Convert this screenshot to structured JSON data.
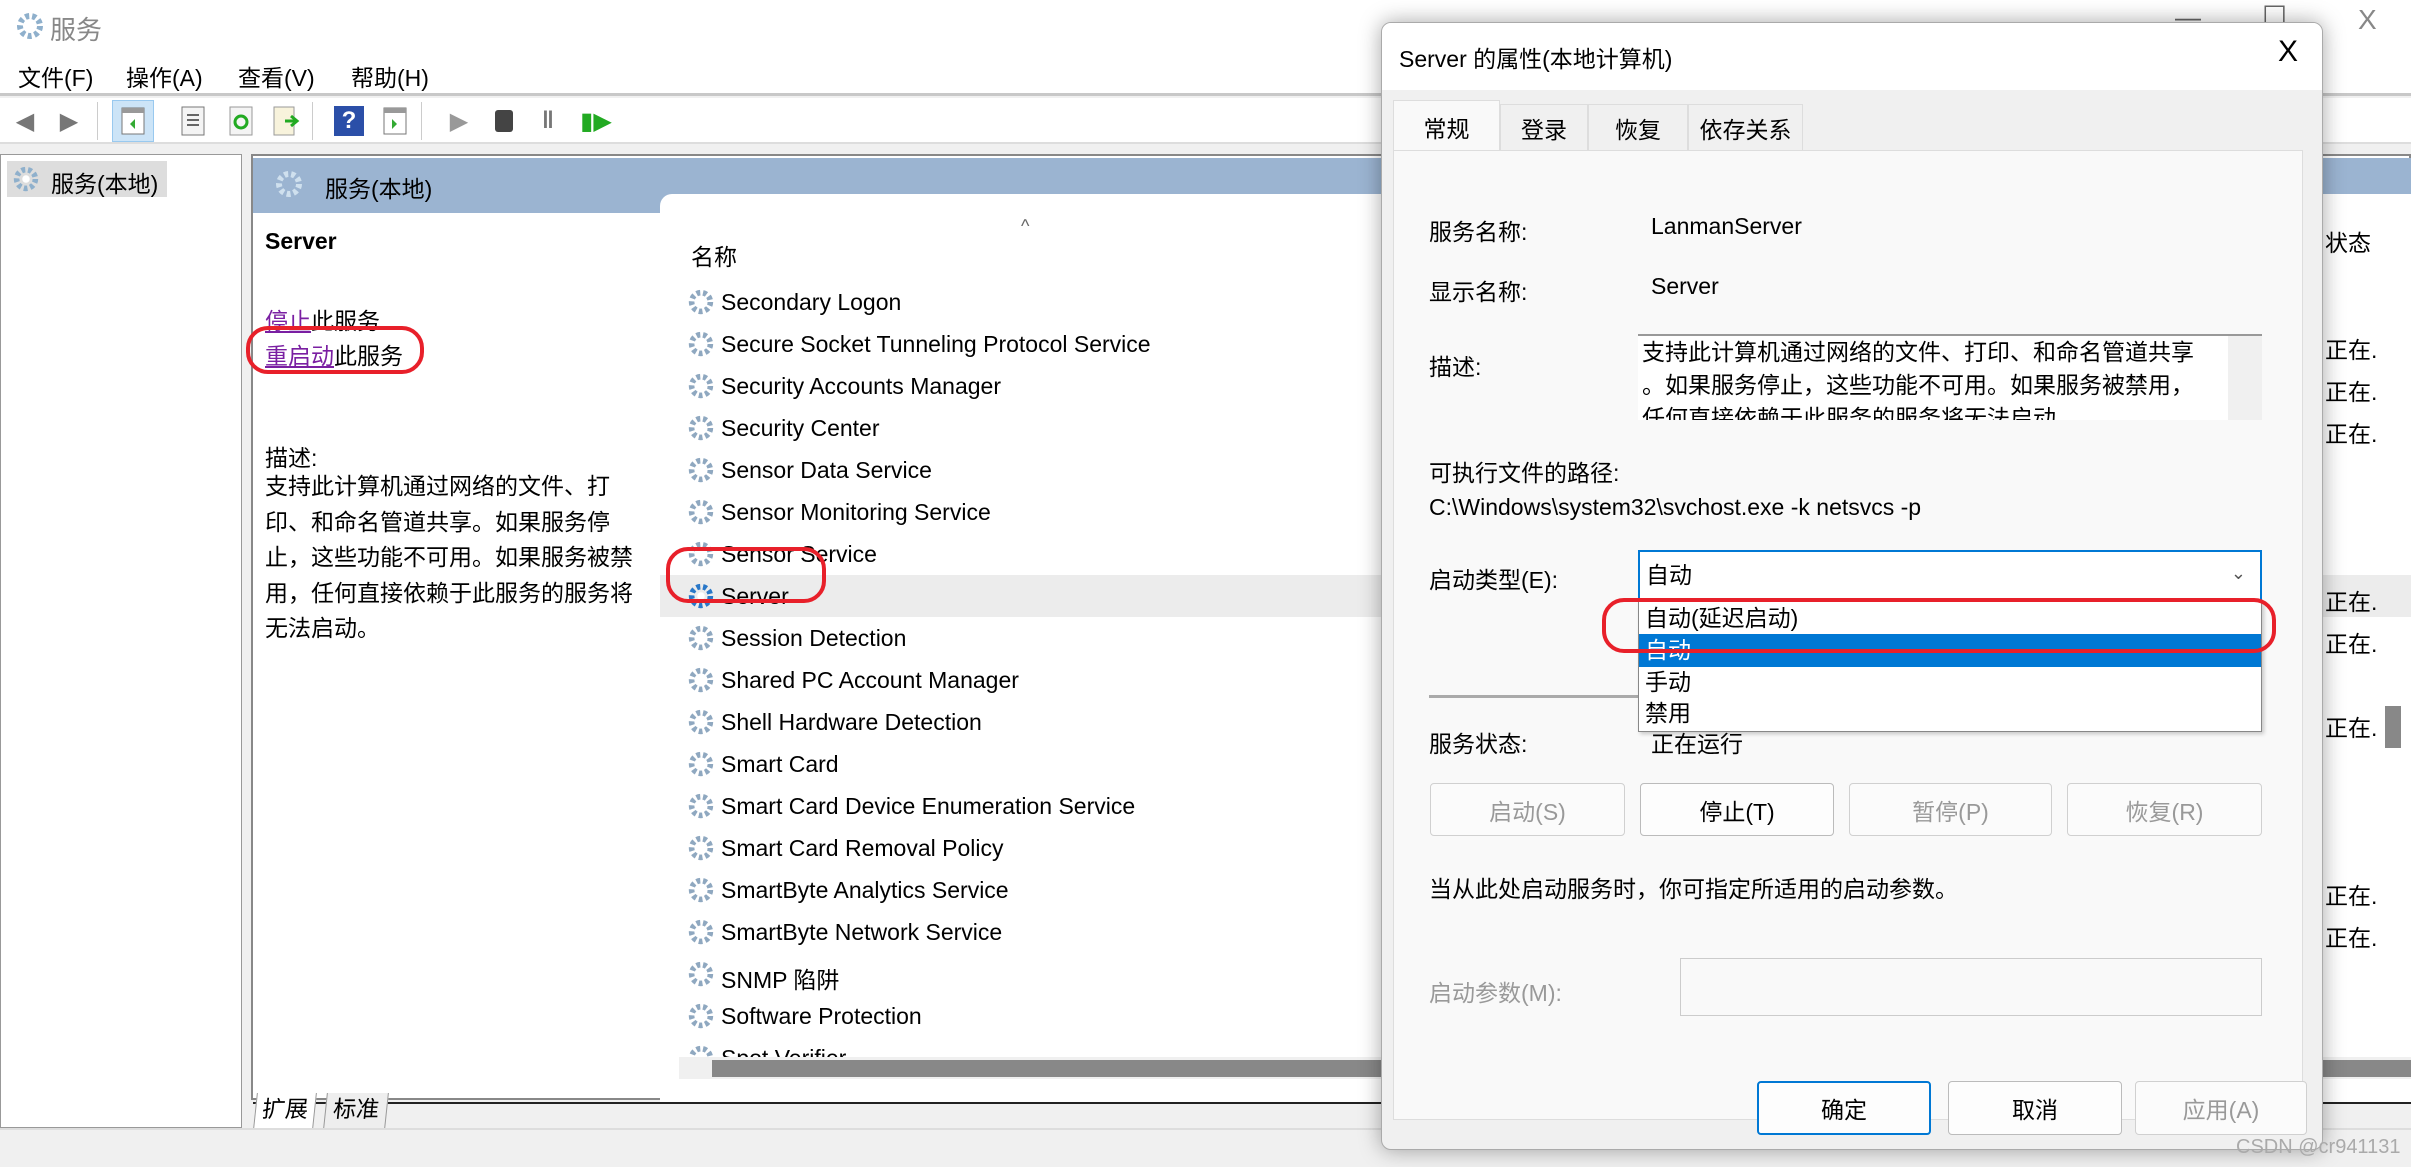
{
  "window": {
    "title": "服务",
    "controls": {
      "minimize": "—",
      "maximize": "☐",
      "close": "X"
    }
  },
  "menu": [
    "文件(F)",
    "操作(A)",
    "查看(V)",
    "帮助(H)"
  ],
  "toolbar": [
    "back-icon",
    "forward-icon",
    "show-hide-console-tree-icon",
    "properties-icon",
    "refresh-icon",
    "export-list-icon",
    "help-icon",
    "show-action-pane-icon",
    "start-service-icon",
    "stop-service-icon",
    "pause-service-icon",
    "resume-service-icon"
  ],
  "tree": {
    "root": "服务(本地)"
  },
  "main": {
    "header": "服务(本地)",
    "detail": {
      "title": "Server",
      "stop_link": "停止",
      "stop_suffix": "此服务",
      "restart_link": "重启动",
      "restart_suffix": "此服务",
      "desc_label": "描述:",
      "desc_lines": [
        "支持此计算机通过网络的文件、打",
        "印、和命名管道共享。如果服务停",
        "止，这些功能不可用。如果服务被禁",
        "用，任何直接依赖于此服务的服务将",
        "无法启动。"
      ]
    },
    "columns": {
      "name": "名称",
      "status": "状态"
    },
    "rows": [
      {
        "name": "Secondary Logon",
        "status": ""
      },
      {
        "name": "Secure Socket Tunneling Protocol Service",
        "status": "正在."
      },
      {
        "name": "Security Accounts Manager",
        "status": "正在."
      },
      {
        "name": "Security Center",
        "status": "正在."
      },
      {
        "name": "Sensor Data Service",
        "status": ""
      },
      {
        "name": "Sensor Monitoring Service",
        "status": ""
      },
      {
        "name": "Sensor Service",
        "status": ""
      },
      {
        "name": "Server",
        "status": "正在.",
        "selected": true
      },
      {
        "name": "Session Detection",
        "status": "正在."
      },
      {
        "name": "Shared PC Account Manager",
        "status": ""
      },
      {
        "name": "Shell Hardware Detection",
        "status": "正在."
      },
      {
        "name": "Smart Card",
        "status": ""
      },
      {
        "name": "Smart Card Device Enumeration Service",
        "status": ""
      },
      {
        "name": "Smart Card Removal Policy",
        "status": ""
      },
      {
        "name": "SmartByte Analytics Service",
        "status": "正在."
      },
      {
        "name": "SmartByte Network Service",
        "status": "正在."
      },
      {
        "name": "SNMP 陷阱",
        "status": ""
      },
      {
        "name": "Software Protection",
        "status": ""
      },
      {
        "name": "Spot Verifier",
        "status": ""
      }
    ],
    "bottom_tabs": [
      "扩展",
      "标准"
    ]
  },
  "dialog": {
    "title": "Server 的属性(本地计算机)",
    "tabs": [
      "常规",
      "登录",
      "恢复",
      "依存关系"
    ],
    "service_name_label": "服务名称:",
    "service_name": "LanmanServer",
    "display_name_label": "显示名称:",
    "display_name": "Server",
    "desc_label": "描述:",
    "desc_lines": [
      "支持此计算机通过网络的文件、打印、和命名管道共享",
      "。如果服务停止，这些功能不可用。如果服务被禁用，",
      "任何直接依赖于此服务的服务将无法启动。"
    ],
    "path_label": "可执行文件的路径:",
    "path": "C:\\Windows\\system32\\svchost.exe -k netsvcs -p",
    "startup_label": "启动类型(E):",
    "startup_value": "自动",
    "startup_options": [
      "自动(延迟启动)",
      "自动",
      "手动",
      "禁用"
    ],
    "startup_highlighted": 1,
    "status_label": "服务状态:",
    "status_value": "正在运行",
    "buttons": {
      "start": "启动(S)",
      "stop": "停止(T)",
      "pause": "暂停(P)",
      "resume": "恢复(R)"
    },
    "hint": "当从此处启动服务时，你可指定所适用的启动参数。",
    "param_label": "启动参数(M):",
    "param_value": "",
    "ok": "确定",
    "cancel": "取消",
    "apply": "应用(A)"
  },
  "watermark": "CSDN @cr941131",
  "colors": {
    "annotation": "#e8202a",
    "accent": "#0078d4",
    "header": "#9bb4d1",
    "link": "#7a1fa2"
  }
}
